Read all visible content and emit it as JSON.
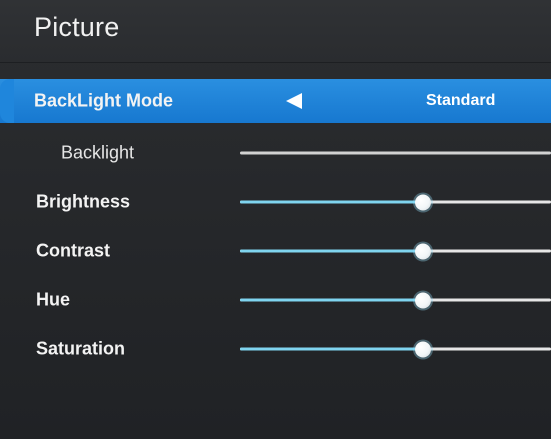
{
  "header": {
    "title": "Picture"
  },
  "menu": {
    "selected_row": {
      "label": "BackLight Mode",
      "arrow_icon": "left-triangle-icon",
      "value": "Standard"
    },
    "rows": [
      {
        "label": "Backlight",
        "value_fraction": 0
      },
      {
        "label": "Brightness",
        "value_fraction": 0.59
      },
      {
        "label": "Contrast",
        "value_fraction": 0.59
      },
      {
        "label": "Hue",
        "value_fraction": 0.59
      },
      {
        "label": "Saturation",
        "value_fraction": 0.59
      }
    ]
  },
  "colors": {
    "selected_row": "#1f86dc",
    "slider_fill": "#7fd4ef",
    "slider_track": "#e6e6e6",
    "background": "#26282b"
  }
}
